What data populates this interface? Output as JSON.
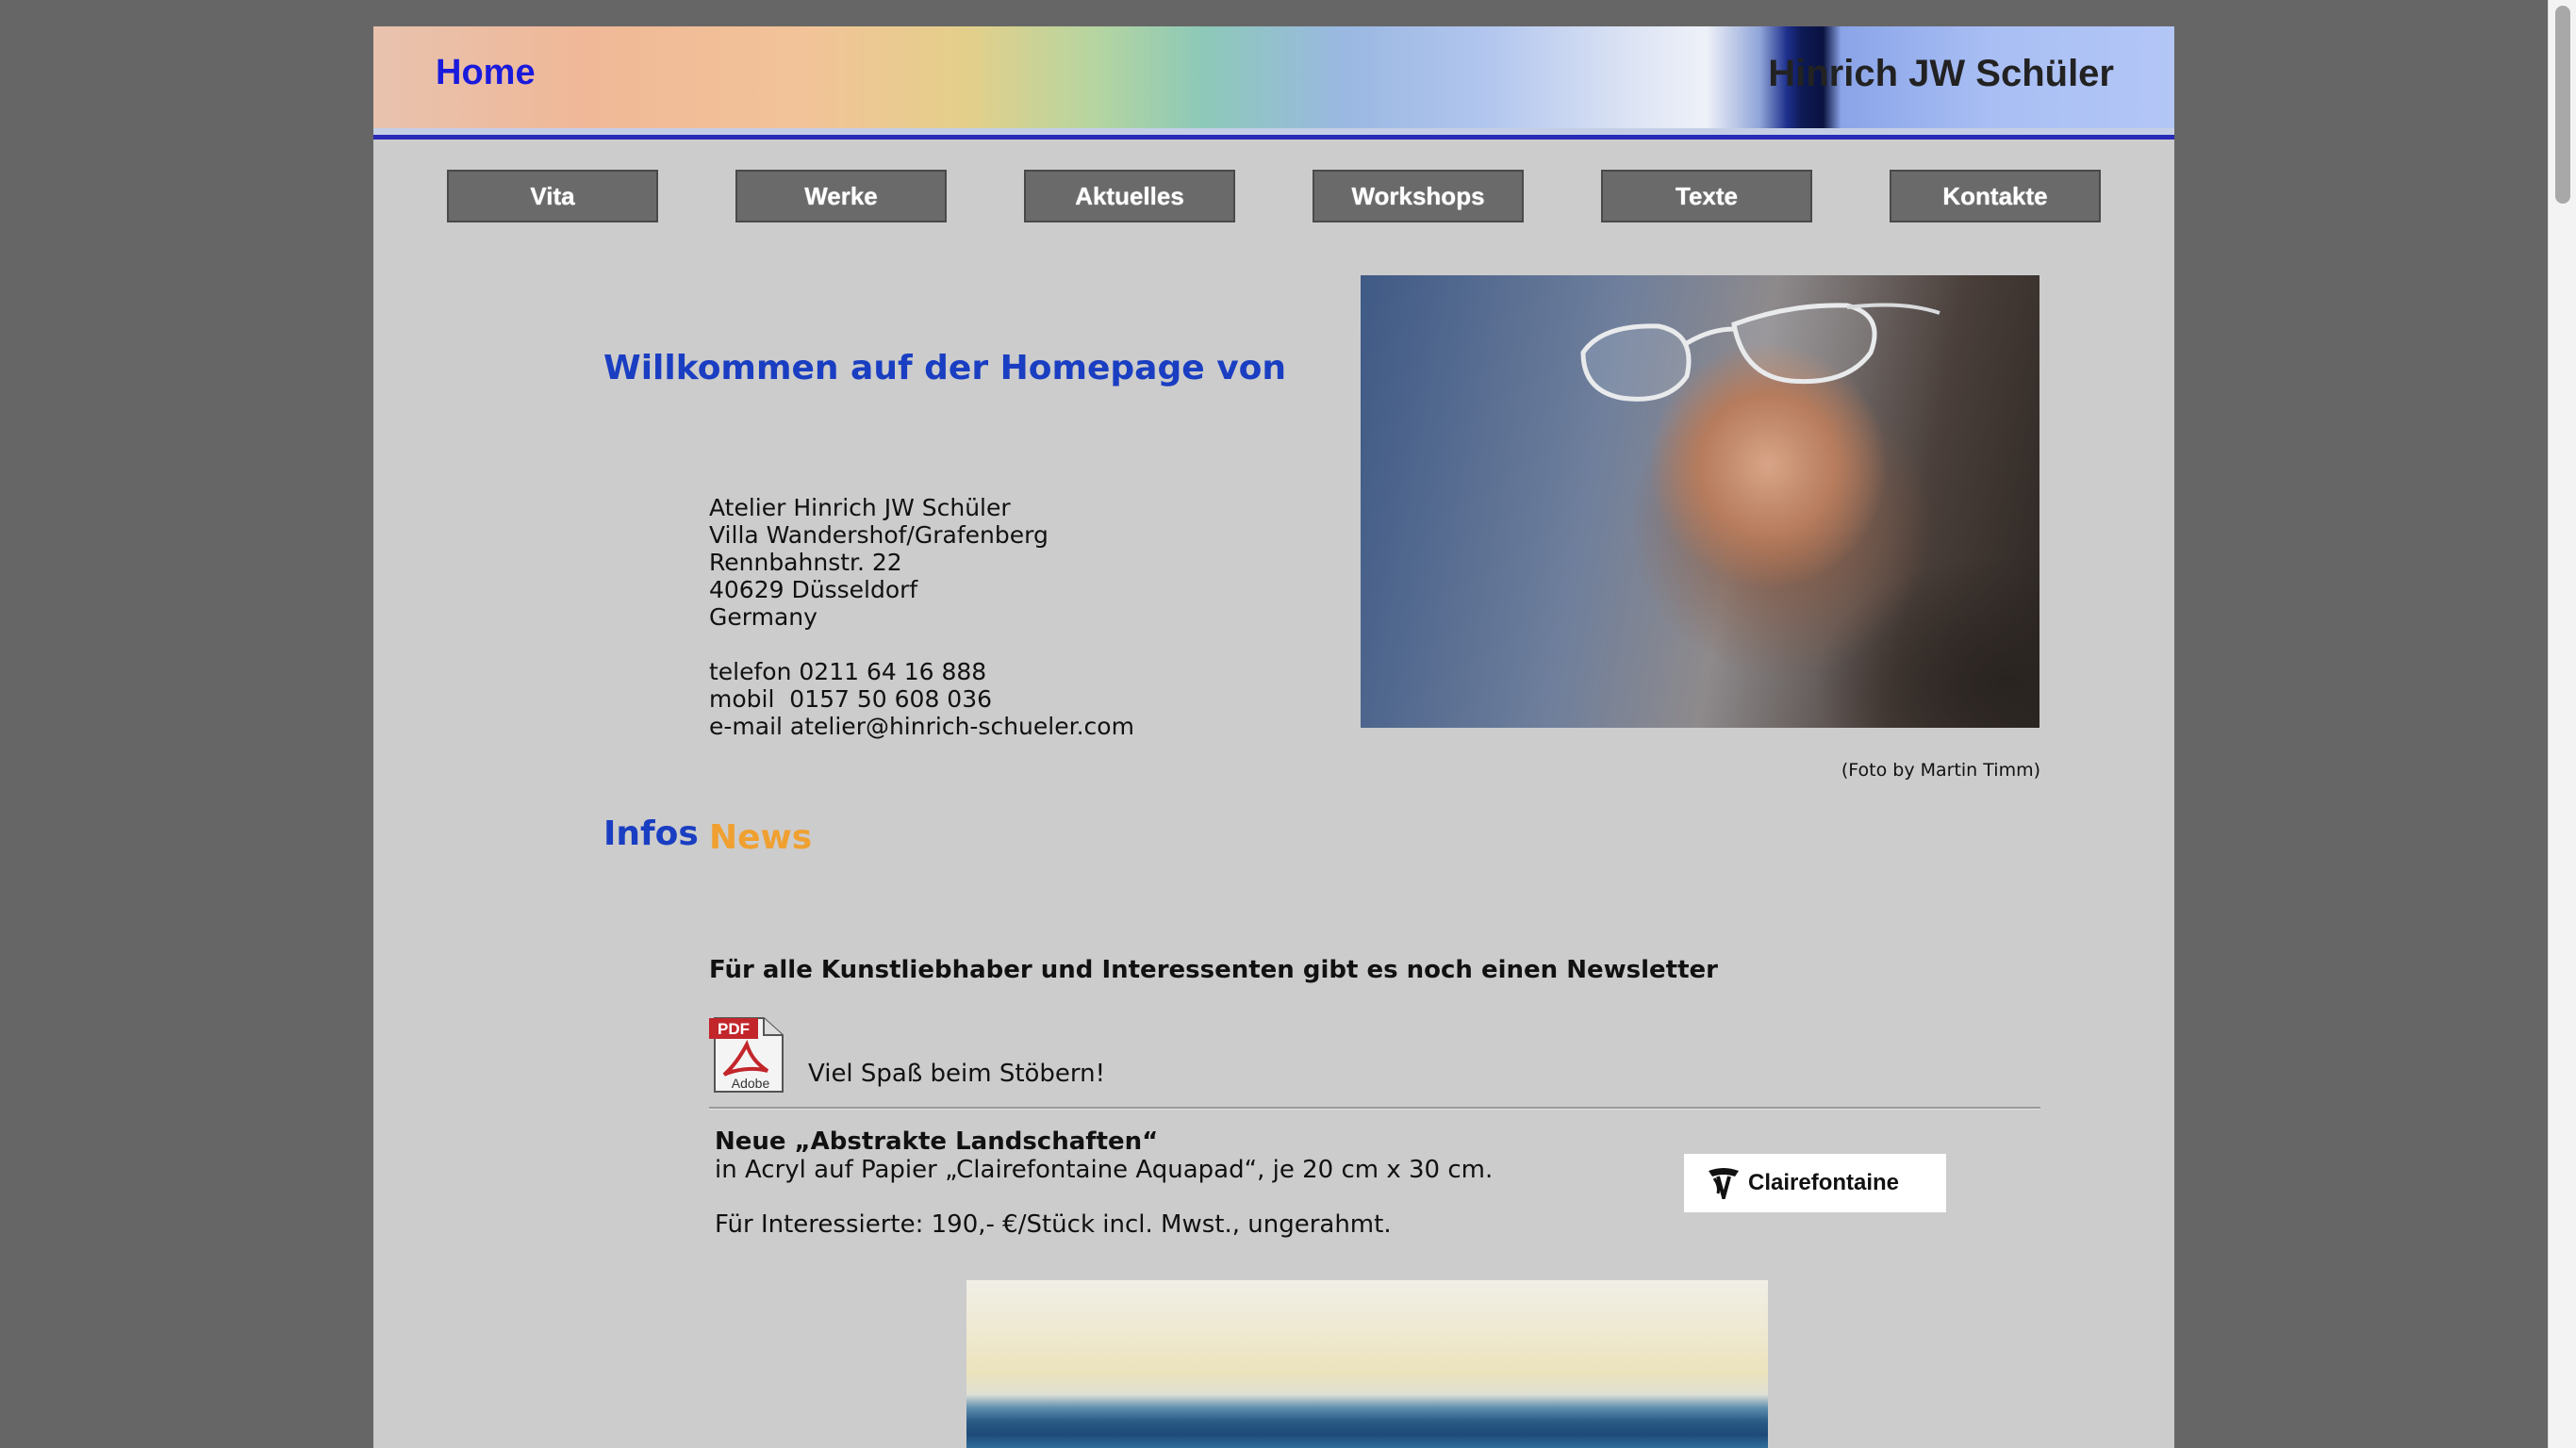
{
  "header": {
    "page_title": "Home",
    "site_name": "Hinrich JW Schüler"
  },
  "nav": {
    "items": [
      {
        "label": "Vita"
      },
      {
        "label": "Werke"
      },
      {
        "label": "Aktuelles"
      },
      {
        "label": "Workshops"
      },
      {
        "label": "Texte"
      },
      {
        "label": "Kontakte"
      }
    ]
  },
  "intro": {
    "welcome": "Willkommen auf der Homepage von",
    "address_lines": [
      "Atelier Hinrich JW Schüler",
      "Villa Wandershof/Grafenberg",
      "Rennbahnstr. 22",
      "40629 Düsseldorf",
      "Germany"
    ],
    "contact_lines": [
      "telefon 0211 64 16 888",
      "mobil  0157 50 608 036",
      "e-mail atelier@hinrich-schueler.com"
    ],
    "photo_credit": "(Foto by Martin Timm)"
  },
  "sections": {
    "infos": "Infos",
    "news": "News"
  },
  "newsletter": {
    "text": "Für alle Kunstliebhaber und Interessenten gibt es noch einen Newsletter",
    "icon_top": "PDF",
    "icon_bottom": "Adobe",
    "fun": "Viel Spaß beim Stöbern!"
  },
  "news_item": {
    "title": "Neue „Abstrakte Landschaften“",
    "description": "in Acryl auf Papier „Clairefontaine Aquapad“, je 20 cm x 30 cm.",
    "price": "Für Interessierte: 190,- €/Stück incl. Mwst., ungerahmt.",
    "partner_logo_text": "Clairefontaine"
  },
  "colors": {
    "page_bg": "#666666",
    "content_bg": "#cccccc",
    "heading_blue": "#1a3ec2",
    "news_orange": "#f0a030",
    "nav_button": "#6a6a6a"
  }
}
